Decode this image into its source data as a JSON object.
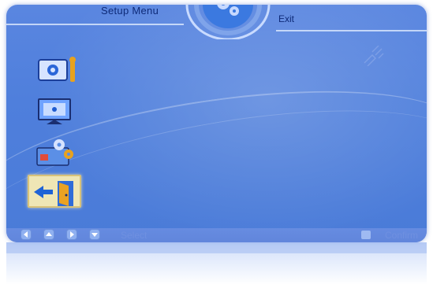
{
  "header": {
    "title": "Setup Menu",
    "exit_label": "Exit"
  },
  "sidebar": {
    "items": [
      {
        "icon": "tv-settings-icon",
        "selected": false
      },
      {
        "icon": "display-icon",
        "selected": false
      },
      {
        "icon": "advanced-settings-icon",
        "selected": false
      },
      {
        "icon": "exit-door-icon",
        "selected": true
      }
    ]
  },
  "footer": {
    "select_label": "Select",
    "confirm_label": "Confirm"
  },
  "colors": {
    "background": "#4f7fdc",
    "text": "#0e2a78",
    "selected": "#efe6b5"
  }
}
